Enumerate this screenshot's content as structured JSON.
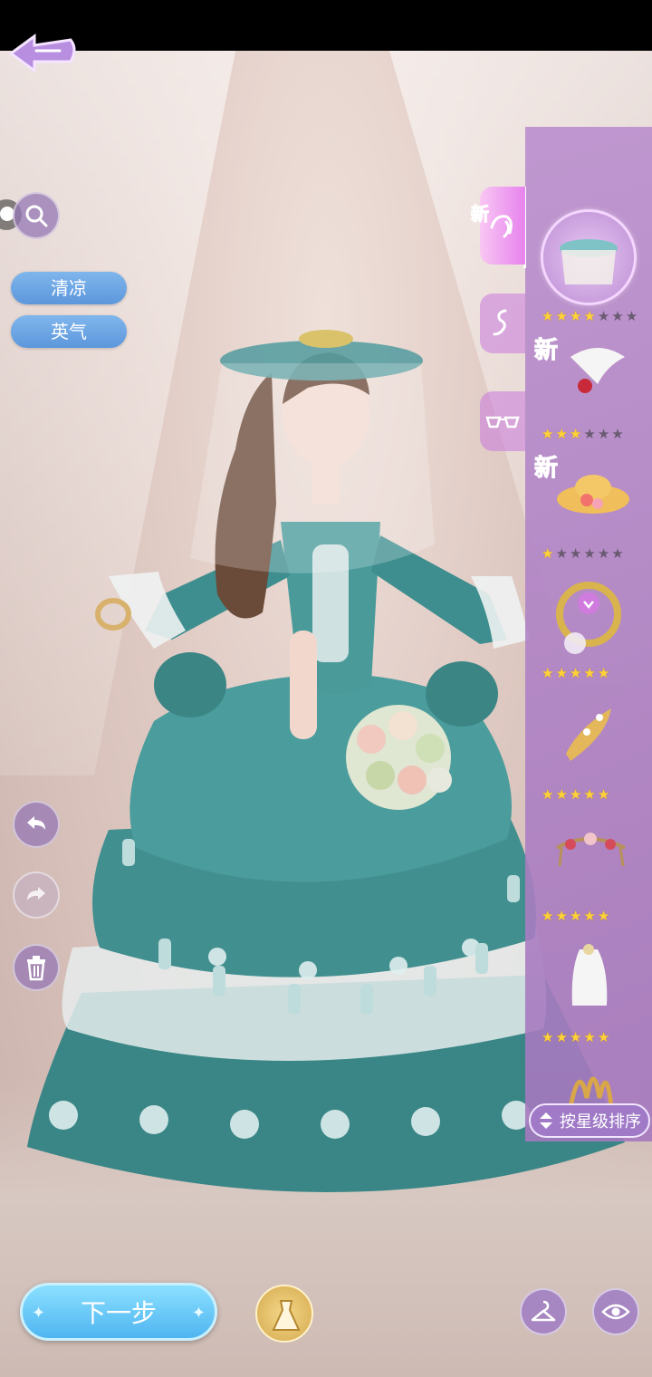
{
  "filters": {
    "tags": [
      "清凉",
      "英气"
    ]
  },
  "categories": [
    {
      "name": "hair-category",
      "new": "新",
      "active": true
    },
    {
      "name": "dress-category",
      "new": "",
      "active": false
    },
    {
      "name": "accessory-category",
      "new": "",
      "active": false
    }
  ],
  "items": [
    {
      "name": "veiled-hat",
      "new": "",
      "rating": 4,
      "max": 7,
      "selected": true
    },
    {
      "name": "white-feather-hairpin",
      "new": "新",
      "rating": 3,
      "max": 6,
      "selected": false
    },
    {
      "name": "straw-flower-hat",
      "new": "新",
      "rating": 1,
      "max": 6,
      "selected": false
    },
    {
      "name": "gold-crescent-earring",
      "new": "",
      "rating": 5,
      "max": 5,
      "selected": false
    },
    {
      "name": "gold-leaf-hairclip",
      "new": "",
      "rating": 5,
      "max": 5,
      "selected": false
    },
    {
      "name": "floral-tiara",
      "new": "",
      "rating": 5,
      "max": 5,
      "selected": false
    },
    {
      "name": "bridal-veil",
      "new": "",
      "rating": 5,
      "max": 5,
      "selected": false
    },
    {
      "name": "gold-ornament",
      "new": "",
      "rating": 0,
      "max": 0,
      "selected": false
    }
  ],
  "sort_button": {
    "label": "按星级排序"
  },
  "bottom_bar": {
    "next_label": "下一步"
  },
  "colors": {
    "panel": "#b48ccd",
    "tag_blue": "#6aa6e4",
    "next_button": "#5cc0f4",
    "dress": "#3f8e8f",
    "new_badge": "#e3128d",
    "star_on": "#ffd23a"
  }
}
